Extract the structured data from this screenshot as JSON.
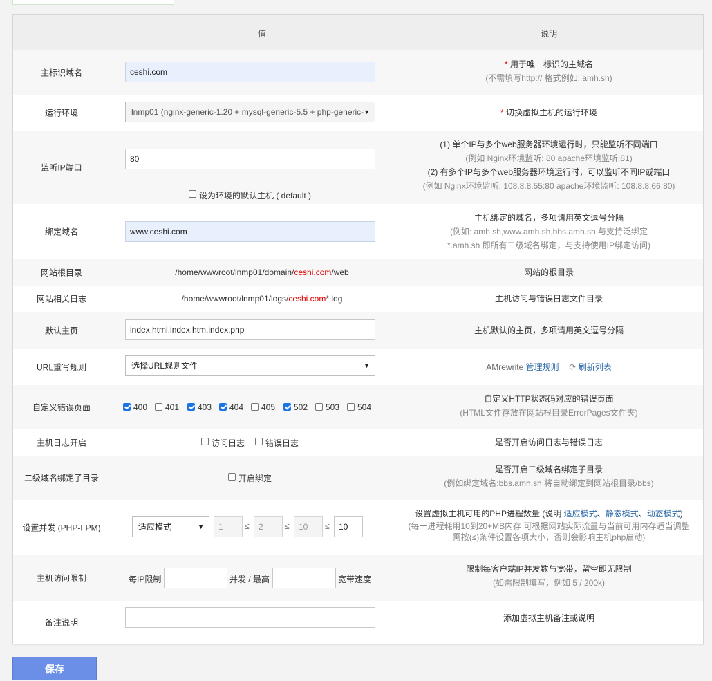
{
  "header": {
    "value_col": "值",
    "desc_col": "说明"
  },
  "rows": {
    "domain": {
      "label": "主标识域名",
      "value": "ceshi.com",
      "desc_star": "*",
      "desc": " 用于唯一标识的主域名",
      "desc_sub": "(不需填写http:// 格式例如: amh.sh)"
    },
    "env": {
      "label": "运行环境",
      "value": "lnmp01 (nginx-generic-1.20 + mysql-generic-5.5 + php-generic-",
      "desc_star": "*",
      "desc": " 切换虚拟主机的运行环境"
    },
    "listen": {
      "label": "监听IP端口",
      "value": "80",
      "checkbox_label": "设为环境的默认主机 ( default )",
      "desc1": "(1) 单个IP与多个web服务器环境运行时，只能监听不同端口",
      "desc2": "(例如 Nginx环境监听: 80   apache环境监听:81)",
      "desc3": "(2) 有多个IP与多个web服务器环境运行时，可以监听不同IP或端口",
      "desc4": "(例如 Nginx环境监听: 108.8.8.55:80   apache环境监听: 108.8.8.66:80)"
    },
    "bind": {
      "label": "绑定域名",
      "value": "www.ceshi.com",
      "desc1": "主机绑定的域名，多项请用英文逗号分隔",
      "desc2": "(例如: amh.sh,www.amh.sh,bbs.amh.sh 与支持泛绑定",
      "desc3": "*.amh.sh 即所有二级域名绑定，与支持使用IP绑定访问)"
    },
    "root": {
      "label": "网站根目录",
      "prefix": "/home/wwwroot/lnmp01/domain/",
      "domain": "ceshi.com",
      "suffix": "/web",
      "desc": "网站的根目录"
    },
    "logs": {
      "label": "网站相关日志",
      "prefix": "/home/wwwroot/lnmp01/logs/",
      "domain": "ceshi.com",
      "suffix": "*.log",
      "desc": "主机访问与错误日志文件目录"
    },
    "index": {
      "label": "默认主页",
      "value": "index.html,index.htm,index.php",
      "desc": "主机默认的主页，多项请用英文逗号分隔"
    },
    "rewrite": {
      "label": "URL重写规则",
      "value": "选择URL规则文件",
      "desc_prefix": "AMrewrite ",
      "manage": "管理规则",
      "refresh": "刷新列表"
    },
    "errors": {
      "label": "自定义错误页面",
      "codes": [
        {
          "code": "400",
          "checked": true
        },
        {
          "code": "401",
          "checked": false
        },
        {
          "code": "403",
          "checked": true
        },
        {
          "code": "404",
          "checked": true
        },
        {
          "code": "405",
          "checked": false
        },
        {
          "code": "502",
          "checked": true
        },
        {
          "code": "503",
          "checked": false
        },
        {
          "code": "504",
          "checked": false
        }
      ],
      "desc1": "自定义HTTP状态码对应的错误页面",
      "desc2": "(HTML文件存放在网站根目录ErrorPages文件夹)"
    },
    "hostlog": {
      "label": "主机日志开启",
      "access": "访问日志",
      "error": "错误日志",
      "desc": "是否开启访问日志与错误日志"
    },
    "subdir": {
      "label": "二级域名绑定子目录",
      "check": "开启绑定",
      "desc1": "是否开启二级域名绑定子目录",
      "desc2": "(例如绑定域名:bbs.amh.sh 将自动绑定到网站根目录/bbs)"
    },
    "fpm": {
      "label": "设置并发 (PHP-FPM)",
      "mode": "适应模式",
      "v1": "1",
      "v2": "2",
      "v3": "10",
      "v4": "10",
      "le": "≤",
      "desc_prefix": "设置虚拟主机可用的PHP进程数量 (说明 ",
      "m1": "适应模式",
      "sep": "、",
      "m2": "静态模式",
      "m3": "动态模式",
      "desc_suffix": ")",
      "desc2": "(每一进程耗用10到20+MB内存 可根据网站实际流量与当前可用内存适当调整",
      "desc3": "需按(≤)条件设置各项大小，否则会影响主机php启动)"
    },
    "limit": {
      "label": "主机访问限制",
      "per_ip": "每IP限制",
      "mid": "并发 / 最高",
      "bw": "宽带速度",
      "desc1": "限制每客户端IP并发数与宽带，留空即无限制",
      "desc2": "(如需限制填写，例如 5 / 200k)"
    },
    "note": {
      "label": "备注说明",
      "value": "",
      "desc": "添加虚拟主机备注或说明"
    }
  },
  "save_label": "保存",
  "colors": {
    "accent": "#1a73e8",
    "link": "#2d6aa8",
    "required": "#dd0000",
    "button": "#6b8ee6"
  }
}
